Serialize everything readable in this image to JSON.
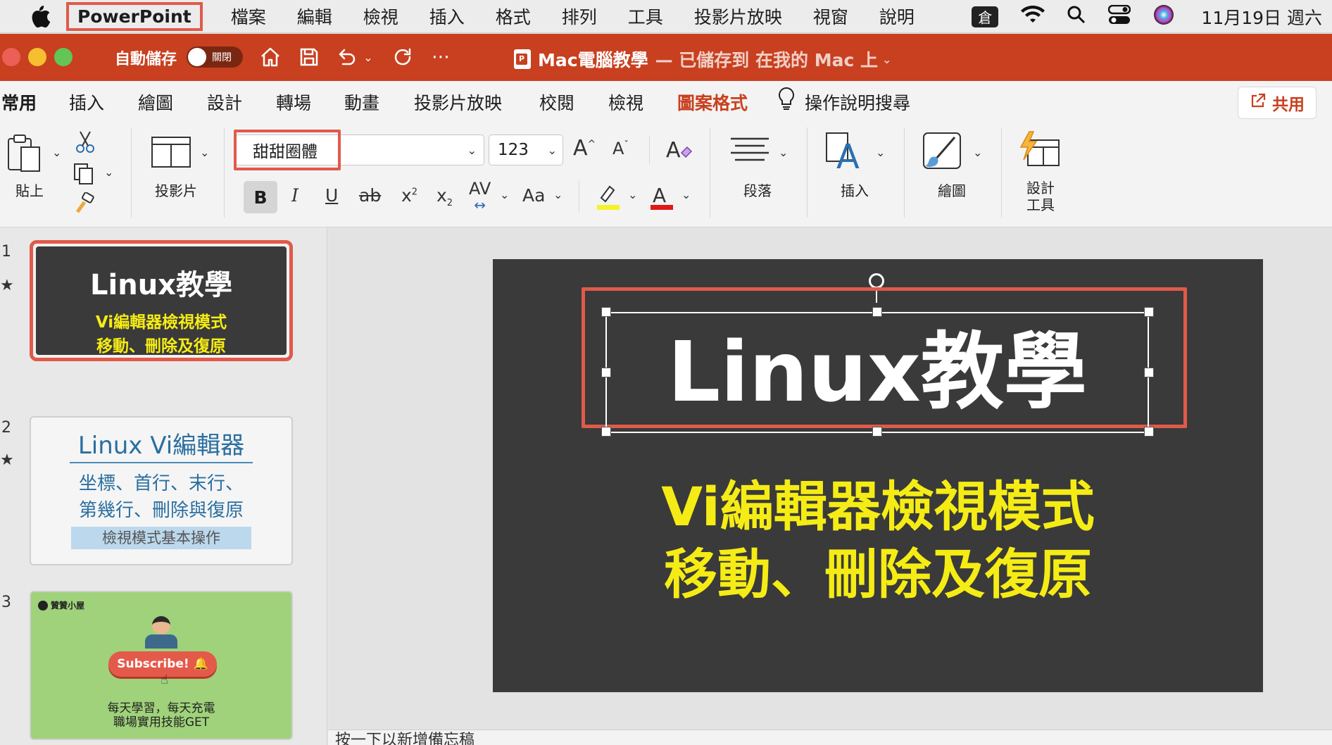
{
  "menubar": {
    "app_name": "PowerPoint",
    "items": [
      "檔案",
      "編輯",
      "檢視",
      "插入",
      "格式",
      "排列",
      "工具",
      "投影片放映",
      "視窗",
      "說明"
    ],
    "clock": "11月19日 週六",
    "status_icons": [
      "input-method-icon",
      "wifi-icon",
      "search-icon",
      "control-center-icon",
      "siri-icon"
    ]
  },
  "titlebar": {
    "autosave_label": "自動儲存",
    "toggle_state": "關閉",
    "doc_title": "Mac電腦教學",
    "doc_status": "— 已儲存到 在我的 Mac 上",
    "accent": "#c8401f"
  },
  "tabs": [
    "常用",
    "插入",
    "繪圖",
    "設計",
    "轉場",
    "動畫",
    "投影片放映",
    "校閱",
    "檢視"
  ],
  "contextual_tab": "圖案格式",
  "tell_me": "操作說明搜尋",
  "share_label": "共用",
  "ribbon": {
    "paste_label": "貼上",
    "slide_label": "投影片",
    "font_name": "甜甜圈體",
    "font_size": "123",
    "paragraph_label": "段落",
    "insert_label": "插入",
    "draw_label": "繪圖",
    "design_label_1": "設計",
    "design_label_2": "工具",
    "format_buttons": {
      "bold": "B",
      "italic": "I",
      "underline": "U",
      "strike": "ab",
      "superscript": "x",
      "subscript": "x",
      "spacing": "AV",
      "case": "Aa",
      "grow": "A",
      "shrink": "A"
    }
  },
  "slides": [
    {
      "number": "1",
      "title": "Linux教學",
      "subtitle_1": "Vi編輯器檢視模式",
      "subtitle_2": "移動、刪除及復原"
    },
    {
      "number": "2",
      "title": "Linux Vi編輯器",
      "line_1": "坐標、首行、末行、",
      "line_2": "第幾行、刪除與復原",
      "tag": "檢視模式基本操作"
    },
    {
      "number": "3",
      "brand": "贊贊小屋",
      "button": "Subscribe! 🔔",
      "line_1": "每天學習，每天充電",
      "line_2": "職場實用技能GET"
    }
  ],
  "main_slide": {
    "title": "Linux教學",
    "subtitle_1": "Vi編輯器檢視模式",
    "subtitle_2": "移動、刪除及復原"
  },
  "notes_placeholder": "按一下以新增備忘稿"
}
